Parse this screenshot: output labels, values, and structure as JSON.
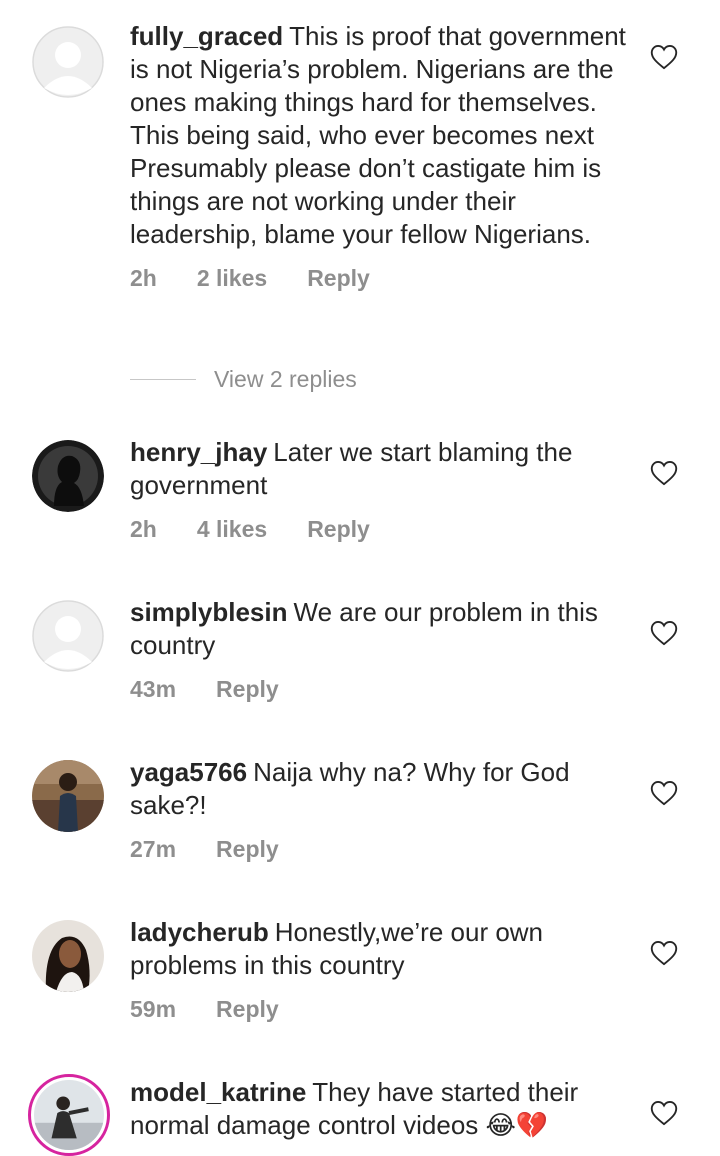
{
  "comments": [
    {
      "username": "fully_graced",
      "text": "This is proof that government is not Nigeria’s problem. Nigerians are the ones making things hard for themselves. This being said, who ever becomes next Presumably please don’t castigate him is things are not working under their leadership, blame your fellow Nigerians.",
      "time": "2h",
      "likes": "2 likes",
      "reply": "Reply",
      "avatar": "default-avatar-icon"
    },
    {
      "username": "henry_jhay",
      "text": "Later we start blaming the government",
      "time": "2h",
      "likes": "4 likes",
      "reply": "Reply",
      "avatar": "silhouette-avatar"
    },
    {
      "username": "simplyblesin",
      "text": "We are our problem in this country",
      "time": "43m",
      "reply": "Reply",
      "avatar": "default-avatar-icon"
    },
    {
      "username": "yaga5766",
      "text": "Naija why na? Why for God sake?!",
      "time": "27m",
      "reply": "Reply",
      "avatar": "photo-avatar"
    },
    {
      "username": "ladycherub",
      "text": "Honestly,we’re our own problems in this country",
      "time": "59m",
      "reply": "Reply",
      "avatar": "photo-avatar"
    },
    {
      "username": "model_katrine",
      "text": "They have started their normal damage control videos 😂💔",
      "avatar": "photo-avatar-story-ring"
    }
  ],
  "view_replies": "View 2 replies",
  "colors": {
    "text": "#262626",
    "meta": "#8e8e8e",
    "story_ring": "#d6249f"
  }
}
